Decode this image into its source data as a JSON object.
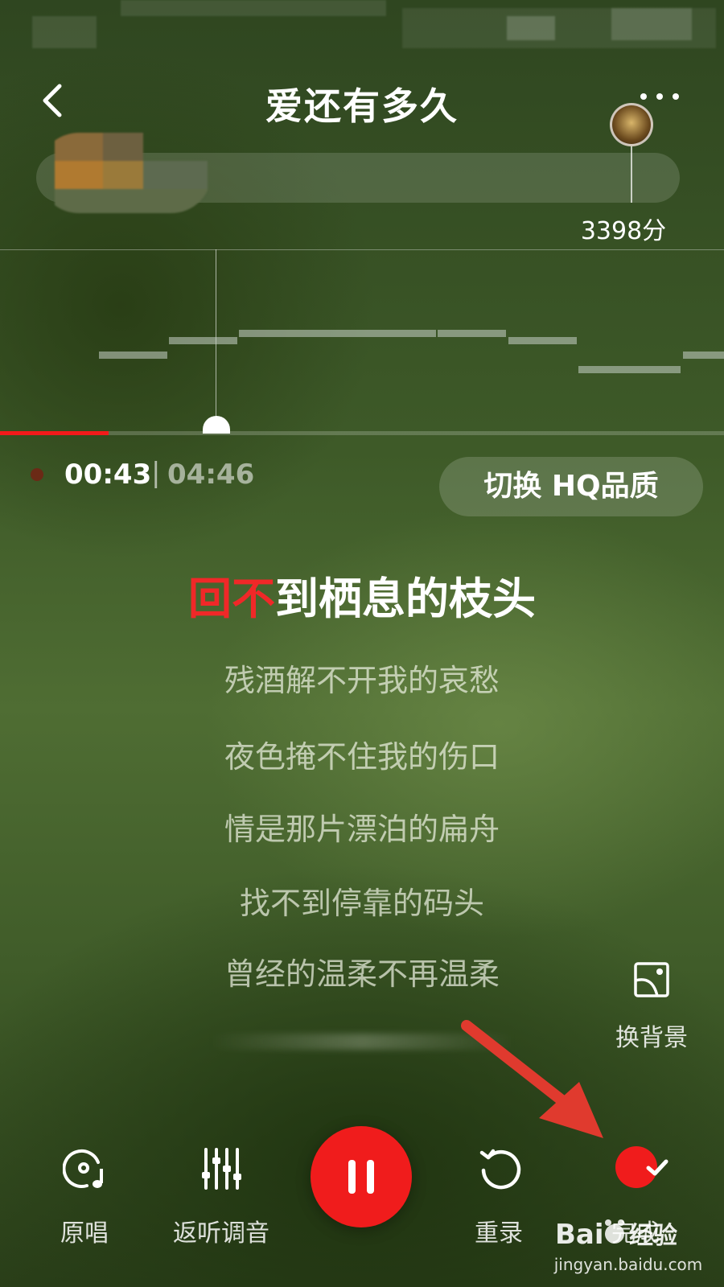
{
  "header": {
    "title": "爱还有多久"
  },
  "score": {
    "value": "3398分",
    "progress_fraction": 0.84
  },
  "playback": {
    "current_time": "00:43",
    "separator": "|",
    "total_time": "04:46",
    "progress_fraction": 0.15
  },
  "quality_button": {
    "label": "切换 HQ品质"
  },
  "lyrics": {
    "current_sung": "回不",
    "current_rest": "到栖息的枝头",
    "upcoming": [
      "残酒解不开我的哀愁",
      "夜色掩不住我的伤口",
      "情是那片漂泊的扁舟",
      "找不到停靠的码头",
      "曾经的温柔不再温柔"
    ]
  },
  "background_button": {
    "label": "换背景",
    "icon": "image-frame-icon"
  },
  "toolbar": {
    "original_label": "原唱",
    "original_icon": "disc-music-icon",
    "playback_label": "返听调音",
    "playback_icon": "sliders-icon",
    "pause_icon": "pause-icon",
    "rerecord_label": "重录",
    "rerecord_icon": "refresh-icon",
    "done_label": "完成",
    "done_icon": "check-icon"
  },
  "colors": {
    "accent": "#f01c1c",
    "annotation_arrow": "#e03a2e"
  },
  "watermark": {
    "logo": "Bai 经验",
    "url": "jingyan.baidu.com"
  }
}
